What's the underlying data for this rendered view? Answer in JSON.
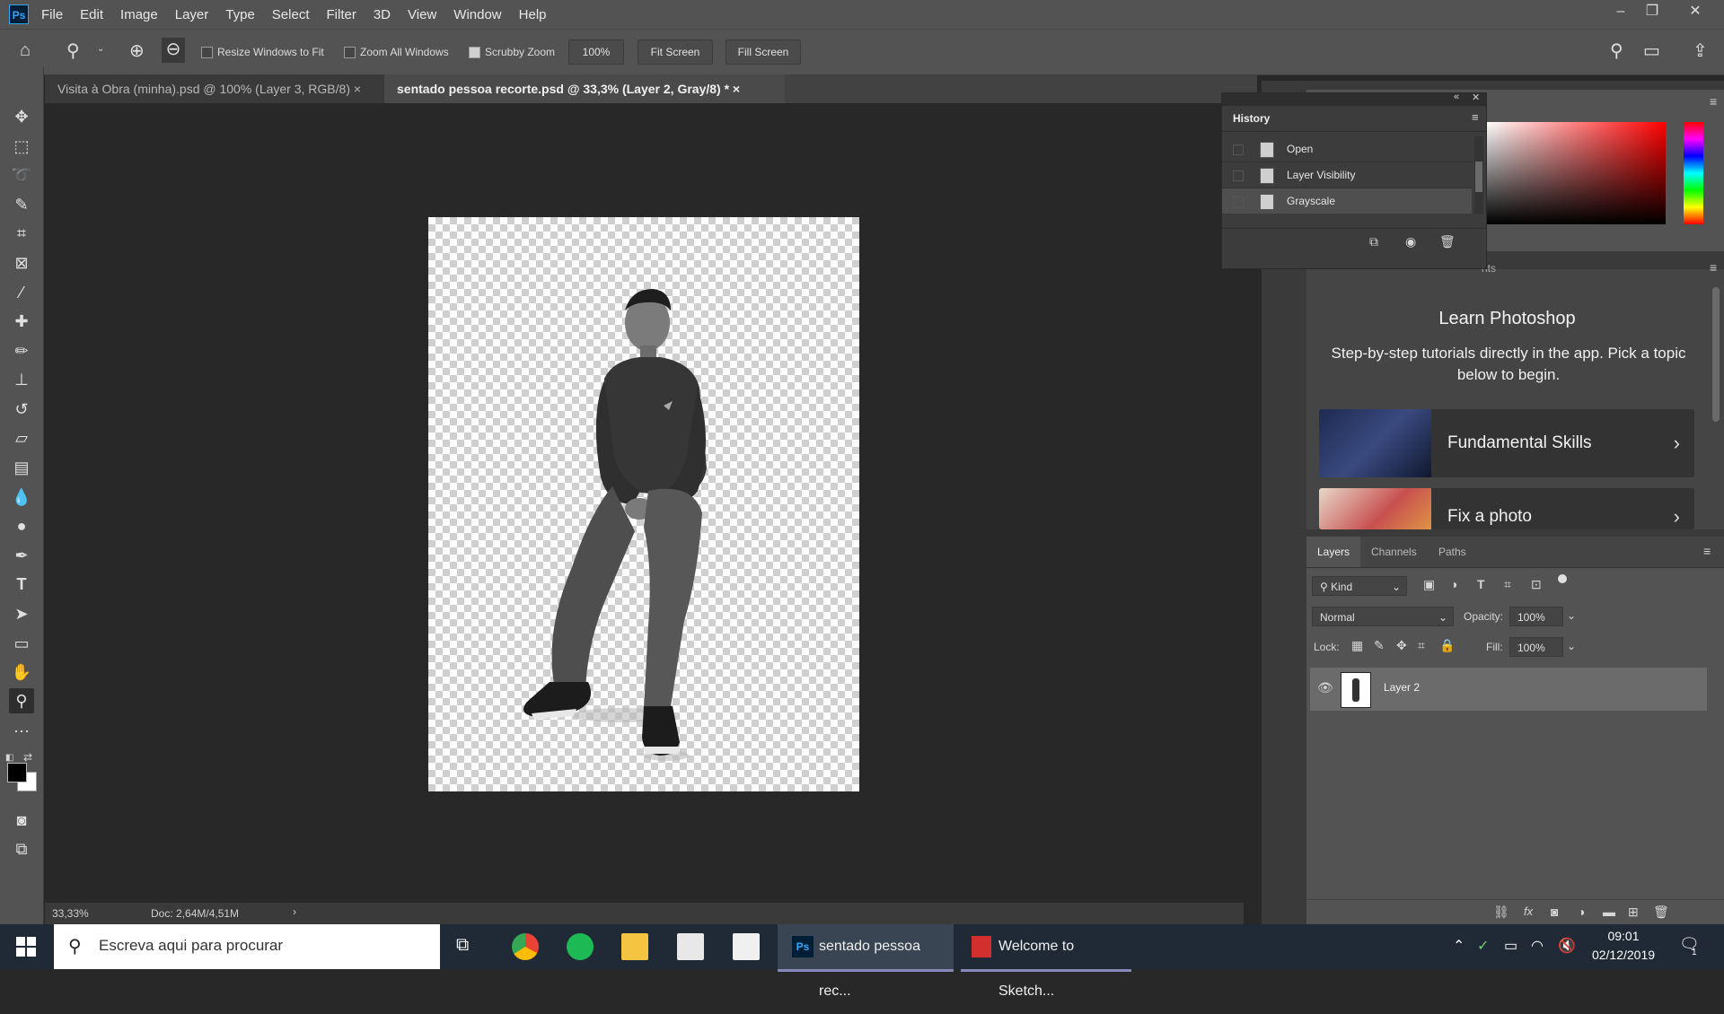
{
  "app": {
    "logo": "Ps",
    "menu": [
      "File",
      "Edit",
      "Image",
      "Layer",
      "Type",
      "Select",
      "Filter",
      "3D",
      "View",
      "Window",
      "Help"
    ]
  },
  "options": {
    "resize_windows": "Resize Windows to Fit",
    "zoom_all": "Zoom All Windows",
    "scrubby": "Scrubby Zoom",
    "zoom_value": "100%",
    "fit_screen": "Fit Screen",
    "fill_screen": "Fill Screen"
  },
  "tabs": [
    {
      "label": "Visita à Obra (minha).psd @ 100% (Layer 3, RGB/8)",
      "close": "×"
    },
    {
      "label": "sentado pessoa recorte.psd @ 33,3% (Layer 2, Gray/8) *",
      "close": "×"
    }
  ],
  "status": {
    "zoom": "33,33%",
    "doc": "Doc: 2,64M/4,51M",
    "arrow": "›"
  },
  "history": {
    "title": "History",
    "items": [
      "Open",
      "Layer Visibility",
      "Grayscale"
    ]
  },
  "learn": {
    "title": "Learn Photoshop",
    "subtitle": "Step-by-step tutorials directly in the app. Pick a topic below to begin.",
    "cards": [
      "Fundamental Skills",
      "Fix a photo"
    ],
    "partial_tab": "nts"
  },
  "layers": {
    "tabs": [
      "Layers",
      "Channels",
      "Paths"
    ],
    "kind": "Kind",
    "blend": "Normal",
    "opacity_label": "Opacity:",
    "opacity": "100%",
    "lock_label": "Lock:",
    "fill_label": "Fill:",
    "fill": "100%",
    "layer_name": "Layer 2"
  },
  "taskbar": {
    "search": "Escreva aqui para procurar",
    "ps_task": "sentado pessoa rec...",
    "sketch_task": "Welcome to Sketch...",
    "time": "09:01",
    "date": "02/12/2019",
    "notif": "1"
  }
}
